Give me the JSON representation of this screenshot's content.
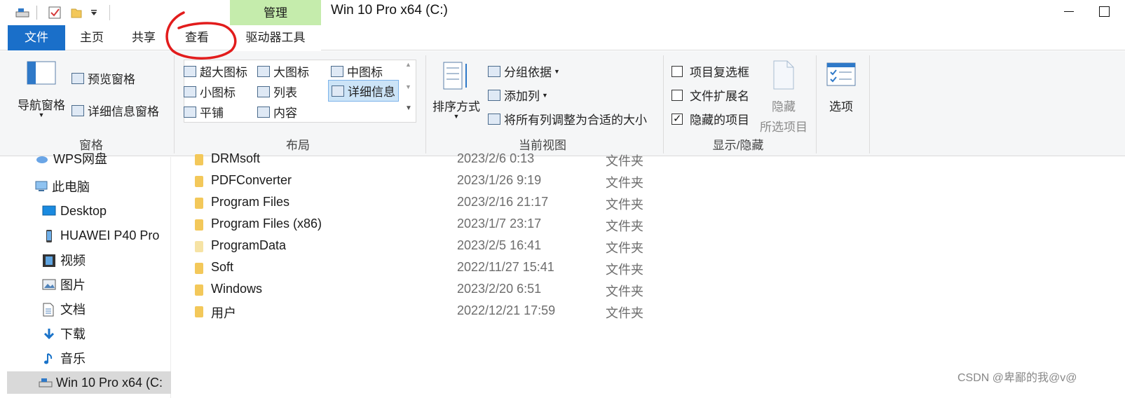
{
  "window": {
    "title": "Win 10 Pro x64 (C:)",
    "contextual_tab": "管理"
  },
  "tabs": [
    {
      "label": "文件"
    },
    {
      "label": "主页"
    },
    {
      "label": "共享"
    },
    {
      "label": "查看"
    },
    {
      "label": "驱动器工具"
    }
  ],
  "ribbon": {
    "panes": {
      "label": "窗格",
      "nav_pane": "导航窗格",
      "preview_pane": "预览窗格",
      "details_pane": "详细信息窗格"
    },
    "layout": {
      "label": "布局",
      "items": [
        "超大图标",
        "大图标",
        "中图标",
        "小图标",
        "列表",
        "详细信息",
        "平铺",
        "内容"
      ],
      "selected": "详细信息"
    },
    "current_view": {
      "label": "当前视图",
      "sort_by": "排序方式",
      "group_by": "分组依据",
      "add_columns": "添加列",
      "size_all_columns": "将所有列调整为合适的大小"
    },
    "show_hide": {
      "label": "显示/隐藏",
      "item_checkboxes": "项目复选框",
      "file_extensions": "文件扩展名",
      "hidden_items": "隐藏的项目",
      "hide_selected_1": "隐藏",
      "hide_selected_2": "所选项目"
    },
    "options": {
      "label": "选项"
    }
  },
  "nav": {
    "items": [
      {
        "label": "WPS网盘",
        "icon": "cloud-drive-icon"
      },
      {
        "label": "此电脑",
        "icon": "computer-icon"
      },
      {
        "label": "Desktop",
        "icon": "desktop-icon"
      },
      {
        "label": "HUAWEI P40 Pro",
        "icon": "phone-icon"
      },
      {
        "label": "视频",
        "icon": "video-icon"
      },
      {
        "label": "图片",
        "icon": "picture-icon"
      },
      {
        "label": "文档",
        "icon": "document-icon"
      },
      {
        "label": "下载",
        "icon": "download-icon"
      },
      {
        "label": "音乐",
        "icon": "music-icon"
      },
      {
        "label": "Win 10 Pro x64 (C:",
        "icon": "drive-icon"
      }
    ]
  },
  "files": [
    {
      "name": "DRMsoft",
      "date": "2023/2/6 0:13",
      "type": "文件夹"
    },
    {
      "name": "PDFConverter",
      "date": "2023/1/26 9:19",
      "type": "文件夹"
    },
    {
      "name": "Program Files",
      "date": "2023/2/16 21:17",
      "type": "文件夹"
    },
    {
      "name": "Program Files (x86)",
      "date": "2023/1/7 23:17",
      "type": "文件夹"
    },
    {
      "name": "ProgramData",
      "date": "2023/2/5 16:41",
      "type": "文件夹"
    },
    {
      "name": "Soft",
      "date": "2022/11/27 15:41",
      "type": "文件夹"
    },
    {
      "name": "Windows",
      "date": "2023/2/20 6:51",
      "type": "文件夹"
    },
    {
      "name": "用户",
      "date": "2022/12/21 17:59",
      "type": "文件夹"
    }
  ],
  "watermark": "CSDN @卑鄙的我@v@",
  "colors": {
    "file_tab": "#1a6fc9",
    "manage_tab": "#c5ecac",
    "annotation": "#e21c1c",
    "folder": "#f3c85a"
  }
}
